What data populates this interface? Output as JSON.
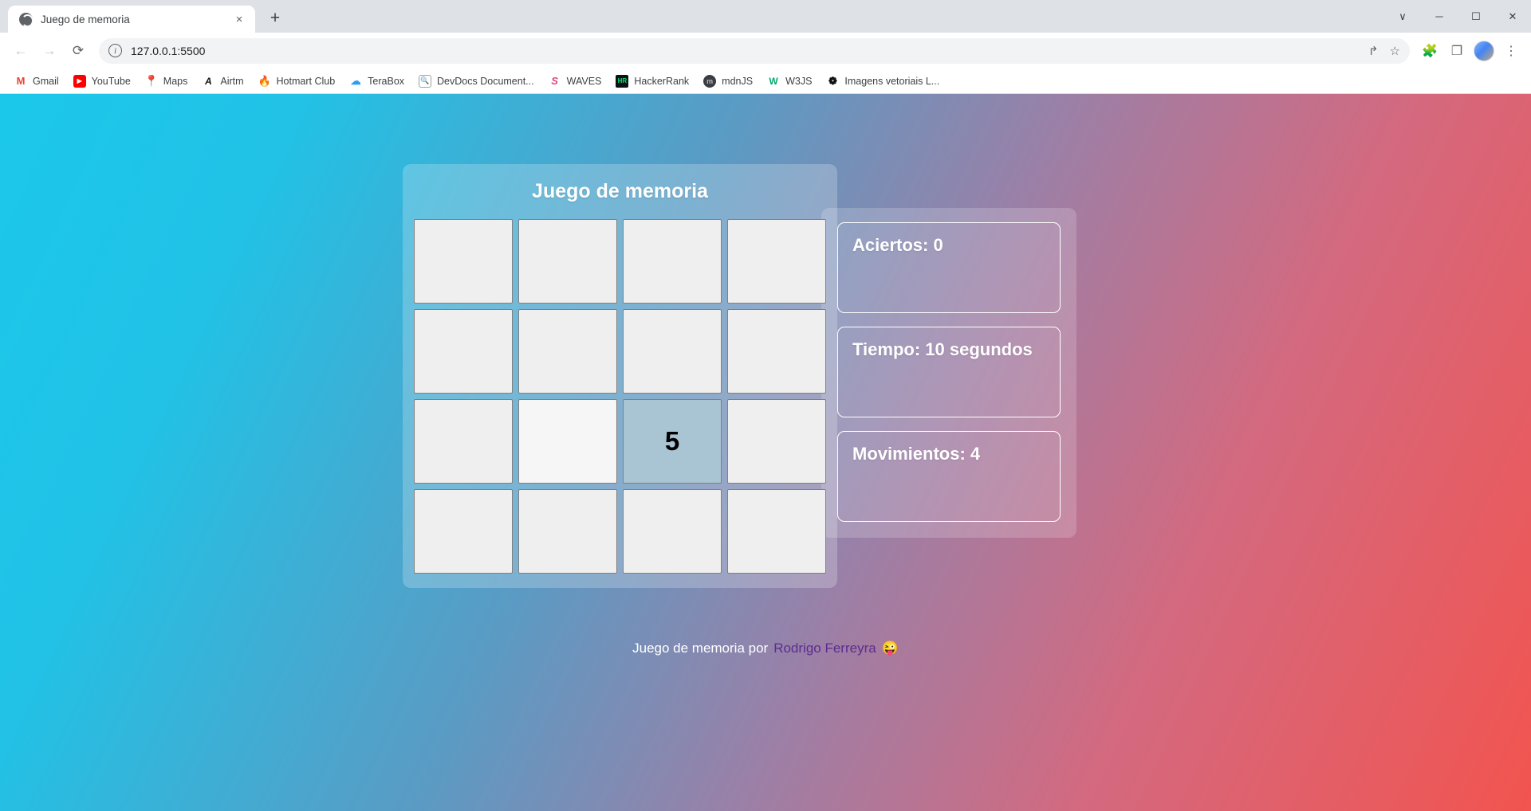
{
  "browser": {
    "tab": {
      "title": "Juego de memoria",
      "favicon": "globe-icon",
      "close": "×"
    },
    "new_tab": "+",
    "window_controls": {
      "expand": "∨",
      "minimize": "─",
      "maximize": "☐",
      "close": "✕"
    },
    "nav": {
      "back": "←",
      "forward": "→",
      "reload": "⟳"
    },
    "omnibox": {
      "info_icon": "i",
      "url": "127.0.0.1:5500",
      "share_icon": "↱",
      "star_icon": "☆"
    },
    "toolbar_icons": {
      "extensions": "🧩",
      "sidepanel": "❐",
      "menu": "⋮"
    },
    "bookmarks": [
      {
        "label": "Gmail",
        "icon": "gmail-icon",
        "glyph": "M"
      },
      {
        "label": "YouTube",
        "icon": "youtube-icon",
        "glyph": "▶"
      },
      {
        "label": "Maps",
        "icon": "maps-icon",
        "glyph": "📍"
      },
      {
        "label": "Airtm",
        "icon": "airtm-icon",
        "glyph": "A"
      },
      {
        "label": "Hotmart Club",
        "icon": "hotmart-icon",
        "glyph": "🔥"
      },
      {
        "label": "TeraBox",
        "icon": "terabox-icon",
        "glyph": "☁"
      },
      {
        "label": "DevDocs Document...",
        "icon": "devdocs-icon",
        "glyph": "🔍"
      },
      {
        "label": "WAVES",
        "icon": "waves-icon",
        "glyph": "S"
      },
      {
        "label": "HackerRank",
        "icon": "hackerrank-icon",
        "glyph": "HR"
      },
      {
        "label": "mdnJS",
        "icon": "mdn-icon",
        "glyph": "m"
      },
      {
        "label": "W3JS",
        "icon": "w3js-icon",
        "glyph": "W"
      },
      {
        "label": "Imagens vetoriais L...",
        "icon": "vector-icon",
        "glyph": "❁"
      }
    ]
  },
  "game": {
    "title": "Juego de memoria",
    "cards": [
      {
        "value": "",
        "state": "hidden"
      },
      {
        "value": "",
        "state": "hidden"
      },
      {
        "value": "",
        "state": "hidden"
      },
      {
        "value": "",
        "state": "hidden"
      },
      {
        "value": "",
        "state": "hidden"
      },
      {
        "value": "",
        "state": "hidden"
      },
      {
        "value": "",
        "state": "hidden"
      },
      {
        "value": "",
        "state": "hidden"
      },
      {
        "value": "",
        "state": "hidden"
      },
      {
        "value": "",
        "state": "hover"
      },
      {
        "value": "5",
        "state": "revealed"
      },
      {
        "value": "",
        "state": "hidden"
      },
      {
        "value": "",
        "state": "hidden"
      },
      {
        "value": "",
        "state": "hidden"
      },
      {
        "value": "",
        "state": "hidden"
      },
      {
        "value": "",
        "state": "hidden"
      }
    ],
    "stats": [
      {
        "name": "aciertos",
        "text": "Aciertos: 0"
      },
      {
        "name": "tiempo",
        "text": "Tiempo: 10 segundos"
      },
      {
        "name": "movimientos",
        "text": "Movimientos: 4"
      }
    ]
  },
  "footer": {
    "prefix": "Juego de memoria por",
    "author": "Rodrigo Ferreyra",
    "emoji": "😜"
  },
  "colors": {
    "gradient_start": "#1bc8ea",
    "gradient_end": "#f2544f",
    "card_face": "#efefef",
    "card_revealed": "#a9c4d2",
    "link": "#5b2d8e"
  }
}
